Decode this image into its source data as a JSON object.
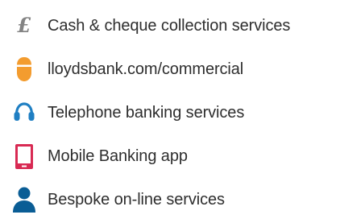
{
  "services": [
    {
      "label": "Cash & cheque collection services",
      "icon": "pound-sign-icon",
      "icon_text": "£",
      "color": "#848484"
    },
    {
      "label": "lloydsbank.com/commercial",
      "icon": "mouse-icon",
      "color": "#f39c2f"
    },
    {
      "label": "Telephone banking services",
      "icon": "headset-icon",
      "color": "#1f7fc3"
    },
    {
      "label": "Mobile Banking app",
      "icon": "mobile-phone-icon",
      "color": "#d82a53"
    },
    {
      "label": "Bespoke on-line services",
      "icon": "person-icon",
      "color": "#0a5d95"
    }
  ]
}
